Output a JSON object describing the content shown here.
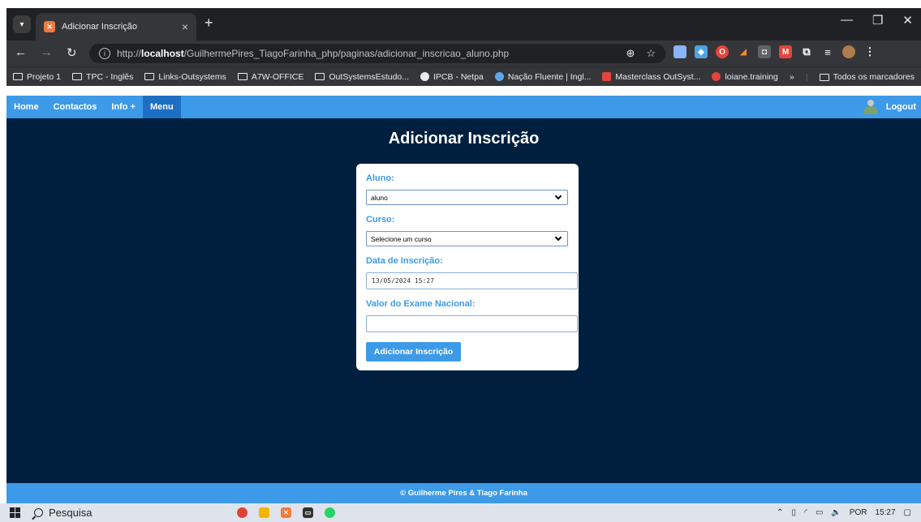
{
  "browser": {
    "tab_title": "Adicionar Inscrição",
    "tab_close": "×",
    "new_tab": "+",
    "url_prefix": "http://",
    "url_host": "localhost",
    "url_path": "/GuilhermePires_TiagoFarinha_php/paginas/adicionar_inscricao_aluno.php",
    "bookmarks": [
      {
        "label": "Projeto 1",
        "icon": "folder-icon"
      },
      {
        "label": "TPC - Inglês",
        "icon": "folder-icon"
      },
      {
        "label": "Links-Outsystems",
        "icon": "folder-icon"
      },
      {
        "label": "A7W-OFFICE",
        "icon": "folder-icon"
      },
      {
        "label": "OutSystemsEstudo...",
        "icon": "folder-icon"
      },
      {
        "label": "IPCB - Netpa",
        "icon": "globe-icon"
      },
      {
        "label": "Nação Fluente | Ingl...",
        "icon": "site-icon"
      },
      {
        "label": "Masterclass OutSyst...",
        "icon": "site-icon"
      },
      {
        "label": "loiane.training",
        "icon": "site-icon"
      }
    ],
    "bookmarks_more": "»",
    "all_bookmarks": "Todos os marcadores"
  },
  "site": {
    "nav": {
      "home": "Home",
      "contactos": "Contactos",
      "info": "Info +",
      "menu": "Menu",
      "logout": "Logout"
    },
    "page_title": "Adicionar Inscrição",
    "form": {
      "aluno_label": "Aluno:",
      "aluno_value": "aluno",
      "curso_label": "Curso:",
      "curso_value": "Selecione um curso",
      "data_label": "Data de Inscrição:",
      "data_value": "13/05/2024 15:27",
      "exame_label": "Valor do Exame Nacional:",
      "exame_value": "",
      "submit_label": "Adicionar Inscrição"
    },
    "footer": "© Guilherme Pires & Tiago Farinha"
  },
  "taskbar": {
    "search_placeholder": "Pesquisa",
    "language": "POR",
    "time": "15:27"
  },
  "colors": {
    "accent": "#3d9ae8",
    "page_bg": "#001f3f",
    "active_nav": "#1c6fc2"
  }
}
